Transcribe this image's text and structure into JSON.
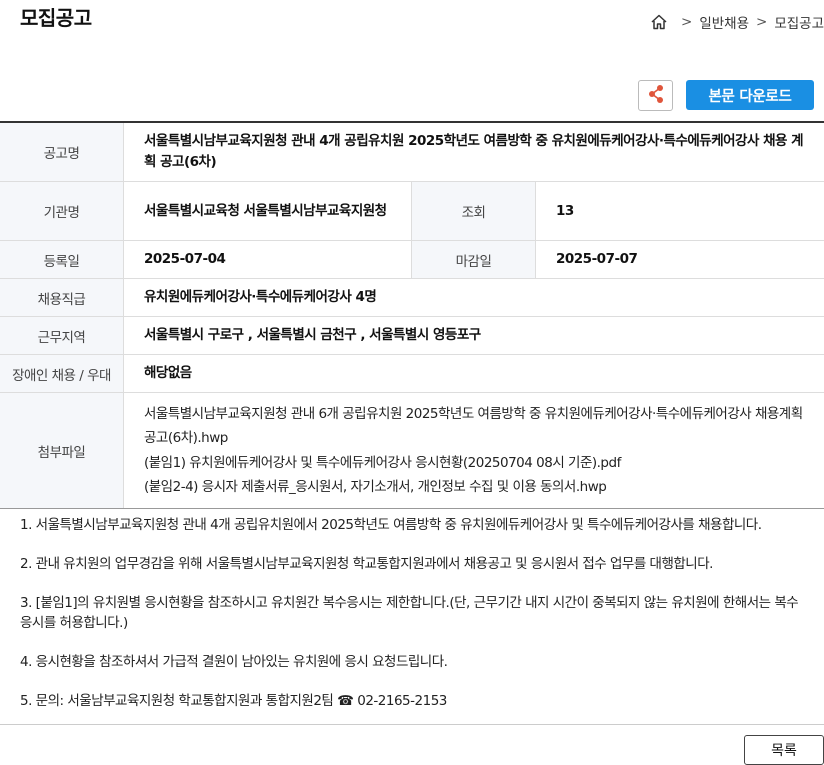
{
  "header": {
    "title": "모집공고",
    "breadcrumb": {
      "sep1": ">",
      "item1": "일반채용",
      "sep2": ">",
      "item2": "모집공고"
    }
  },
  "toolbar": {
    "share_icon": "share-icon",
    "download_label": "본문 다운로드"
  },
  "info": {
    "announcement_label": "공고명",
    "announcement_value": "서울특별시남부교육지원청 관내 4개 공립유치원 2025학년도 여름방학 중 유치원에듀케어강사·특수에듀케어강사 채용 계획 공고(6차)",
    "org_label": "기관명",
    "org_value": "서울특별시교육청 서울특별시남부교육지원청",
    "views_label": "조회",
    "views_value": "13",
    "reg_label": "등록일",
    "reg_value": "2025-07-04",
    "deadline_label": "마감일",
    "deadline_value": "2025-07-07",
    "job_label": "채용직급",
    "job_value": "유치원에듀케어강사·특수에듀케어강사 4명",
    "region_label": "근무지역",
    "region_value": "서울특별시 구로구 , 서울특별시 금천구 , 서울특별시 영등포구",
    "disabled_label": "장애인 채용 / 우대",
    "disabled_value": "해당없음",
    "files_label": "첨부파일",
    "files": [
      "서울특별시남부교육지원청 관내 6개 공립유치원 2025학년도 여름방학 중 유치원에듀케어강사·특수에듀케어강사 채용계획 공고(6차).hwp",
      "(붙임1) 유치원에듀케어강사 및 특수에듀케어강사 응시현황(20250704 08시 기준).pdf",
      "(붙임2-4) 응시자 제출서류_응시원서, 자기소개서, 개인정보 수집 및 이용 동의서.hwp"
    ]
  },
  "body": {
    "p1": "1. 서울특별시남부교육지원청 관내 4개 공립유치원에서 2025학년도 여름방학 중 유치원에듀케어강사 및 특수에듀케어강사를 채용합니다.",
    "p2": "2. 관내 유치원의 업무경감을 위해 서울특별시남부교육지원청 학교통합지원과에서 채용공고 및 응시원서 접수 업무를 대행합니다.",
    "p3": "3. [붙임1]의 유치원별 응시현황을 참조하시고 유치원간 복수응시는 제한합니다.(단, 근무기간 내지 시간이 중복되지 않는 유치원에 한해서는 복수응시를 허용합니다.)",
    "p4": "4. 응시현황을 참조하셔서 가급적 결원이 남아있는 유치원에 응시 요청드립니다.",
    "p5": "5. 문의: 서울남부교육지원청 학교통합지원과 통합지원2팀 ☎ 02-2165-2153"
  },
  "footer": {
    "list_label": "목록"
  }
}
